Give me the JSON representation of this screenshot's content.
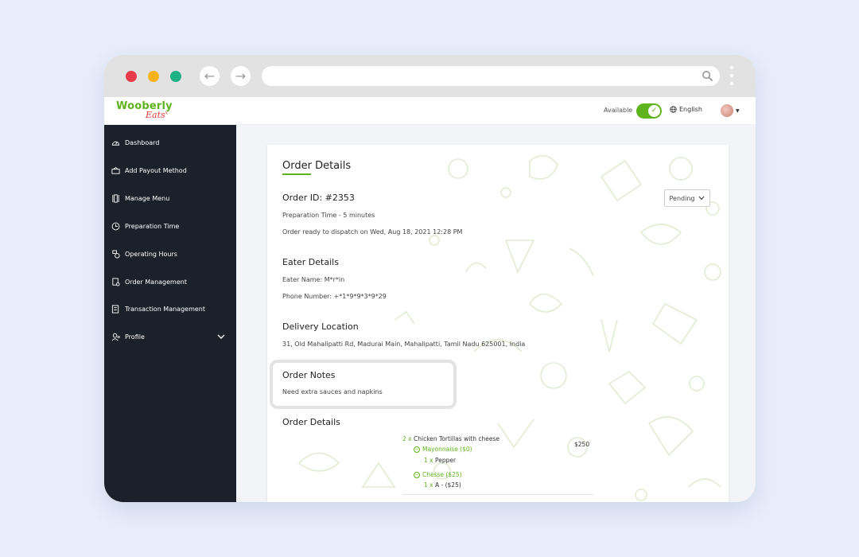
{
  "brand": {
    "line1": "Wooberly",
    "line2": "Eats",
    "mark": "x",
    "green": "#5fb31c",
    "red": "#e23a3a"
  },
  "header": {
    "available_label": "Available",
    "language": "English",
    "toggle_on": true
  },
  "sidebar": {
    "items": [
      {
        "label": "Dashboard",
        "icon": "dashboard-gauge-icon"
      },
      {
        "label": "Add Payout Method",
        "icon": "payout-icon"
      },
      {
        "label": "Manage Menu",
        "icon": "menu-icon"
      },
      {
        "label": "Preparation Time",
        "icon": "clock-icon"
      },
      {
        "label": "Operating Hours",
        "icon": "hours-icon"
      },
      {
        "label": "Order Management",
        "icon": "order-icon"
      },
      {
        "label": "Transaction Management",
        "icon": "transaction-icon"
      },
      {
        "label": "Profile",
        "icon": "profile-icon"
      }
    ]
  },
  "order": {
    "title": "Order Details",
    "id_label": "Order ID: #2353",
    "status": "Pending",
    "prep_time": "Preparation Time - 5 minutes",
    "dispatch": "Order ready to dispatch on Wed, Aug 18, 2021 12:28 PM"
  },
  "eater": {
    "heading": "Eater Details",
    "name": "Eater Name: M*r*in",
    "phone": "Phone Number: +*1*9*9*3*9*29"
  },
  "delivery": {
    "heading": "Delivery Location",
    "address": "31, Old Mahalipatti Rd, Madurai Main, Mahalipatti, Tamil Nadu 625001, India"
  },
  "notes": {
    "heading": "Order Notes",
    "text": "Need extra sauces and napkins"
  },
  "items": {
    "heading": "Order Details",
    "line": {
      "qty": "2 x",
      "name": "Chicken Tortillas with cheese",
      "price": "$250"
    },
    "mods": [
      {
        "name": "Mayonnaise ($0)",
        "sub_qty": "1 x",
        "sub_name": "Pepper"
      },
      {
        "name": "Chesse ($25)",
        "sub_qty": "1 x",
        "sub_name": "A - ($25)"
      }
    ]
  }
}
